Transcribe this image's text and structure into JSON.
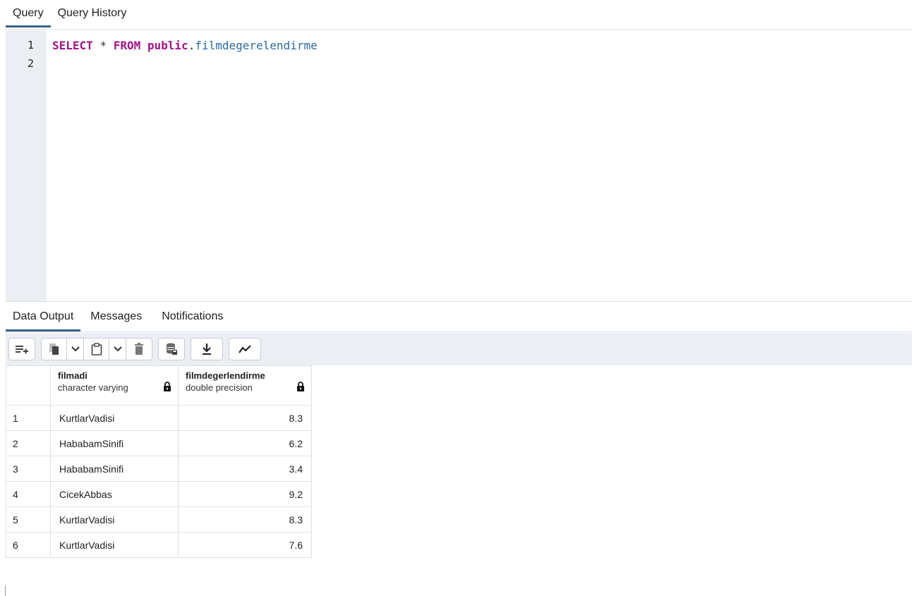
{
  "top_tabs": [
    {
      "label": "Query",
      "active": true
    },
    {
      "label": "Query History",
      "active": false
    }
  ],
  "editor": {
    "line_numbers": [
      "1",
      "2"
    ],
    "code": {
      "select": "SELECT",
      "star": "*",
      "from": "FROM",
      "schema": "public",
      "dot": ".",
      "table": "filmdegerelendirme"
    }
  },
  "output_tabs": [
    {
      "label": "Data Output",
      "active": true
    },
    {
      "label": "Messages",
      "active": false
    },
    {
      "label": "Notifications",
      "active": false
    }
  ],
  "toolbar": {
    "icons": [
      "add-row-icon",
      "copy-icon",
      "chevron-down-icon",
      "paste-icon",
      "chevron-down-icon",
      "delete-icon",
      "save-data-icon",
      "download-icon",
      "graph-icon"
    ]
  },
  "grid": {
    "columns": [
      {
        "name": "filmadi",
        "type": "character varying"
      },
      {
        "name": "filmdegerlendirme",
        "type": "double precision"
      }
    ],
    "rows": [
      {
        "num": "1",
        "filmadi": "KurtlarVadisi",
        "value": "8.3"
      },
      {
        "num": "2",
        "filmadi": "HababamSinifi",
        "value": "6.2"
      },
      {
        "num": "3",
        "filmadi": "HababamSinifi",
        "value": "3.4"
      },
      {
        "num": "4",
        "filmadi": "CicekAbbas",
        "value": "9.2"
      },
      {
        "num": "5",
        "filmadi": "KurtlarVadisi",
        "value": "8.3"
      },
      {
        "num": "6",
        "filmadi": "KurtlarVadisi",
        "value": "7.6"
      }
    ]
  },
  "colors": {
    "accent": "#326690",
    "keyword": "#a3128a",
    "identifier": "#2a6aa5",
    "gutter": "#ebeef3"
  }
}
